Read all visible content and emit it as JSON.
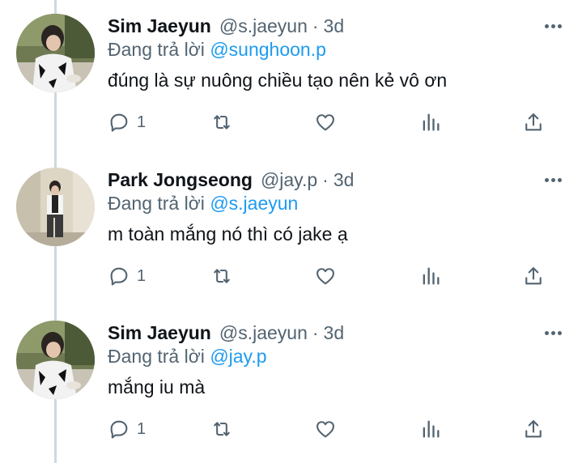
{
  "tweets": [
    {
      "name": "Sim Jaeyun",
      "handle": "@s.jaeyun",
      "time": "3d",
      "reply_prefix": "Đang trả lời",
      "reply_to": "@sunghoon.p",
      "text": "đúng là sự nuông chiều tạo nên kẻ vô ơn",
      "reply_count": "1"
    },
    {
      "name": "Park Jongseong",
      "handle": "@jay.p",
      "time": "3d",
      "reply_prefix": "Đang trả lời",
      "reply_to": "@s.jaeyun",
      "text": "m toàn mắng nó thì có jake ạ",
      "reply_count": "1"
    },
    {
      "name": "Sim Jaeyun",
      "handle": "@s.jaeyun",
      "time": "3d",
      "reply_prefix": "Đang trả lời",
      "reply_to": "@jay.p",
      "text": "mắng iu mà",
      "reply_count": "1"
    }
  ],
  "separator": "·",
  "icons": {
    "reply": "comment-icon",
    "retweet": "retweet-icon",
    "like": "heart-icon",
    "views": "bar-chart-icon",
    "share": "share-icon",
    "more": "more-icon"
  },
  "colors": {
    "mention": "#1d9bf0",
    "secondary": "#536471",
    "primary": "#0f1419",
    "thread_line": "#cfd9de"
  }
}
